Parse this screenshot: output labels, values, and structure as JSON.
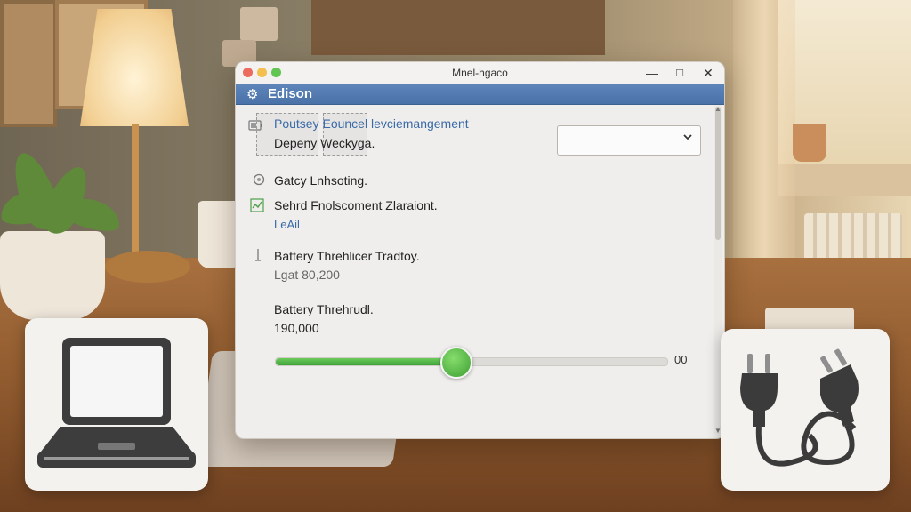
{
  "window": {
    "title": "Mnel-hgaco",
    "minimize": "—",
    "maximize": "□",
    "close": "✕"
  },
  "header": {
    "title": "Edison",
    "icon": "gear-icon"
  },
  "rows": {
    "power_source": {
      "icon": "battery-icon",
      "label": "Poutsey Eouncel levciemangement",
      "value": "Depeny Weckyga."
    },
    "dropdown": {
      "value": "",
      "icon": "chevron-down-icon"
    },
    "gateway": {
      "icon": "refresh-icon",
      "label": "Gatcy Lnhsoting."
    },
    "performance": {
      "icon": "chart-icon",
      "label": "Sehrd Fnolscoment Zlaraiont.",
      "link": "LeAil"
    },
    "battery_threshold_1": {
      "icon": "pin-icon",
      "label": "Battery Threhlicer Tradtoy.",
      "value": "Lgat 80,200"
    },
    "battery_threshold_2": {
      "label": "Battery Threhrudl.",
      "value": "190,000"
    }
  },
  "slider": {
    "value_fraction": 0.46,
    "readout": "00"
  },
  "colors": {
    "accent_header": "#4f78ad",
    "slider_fill": "#4fb545",
    "link": "#3a6aa8"
  },
  "cards": {
    "left": {
      "icon": "laptop-icon"
    },
    "right": {
      "icon": "power-plug-icon"
    }
  }
}
